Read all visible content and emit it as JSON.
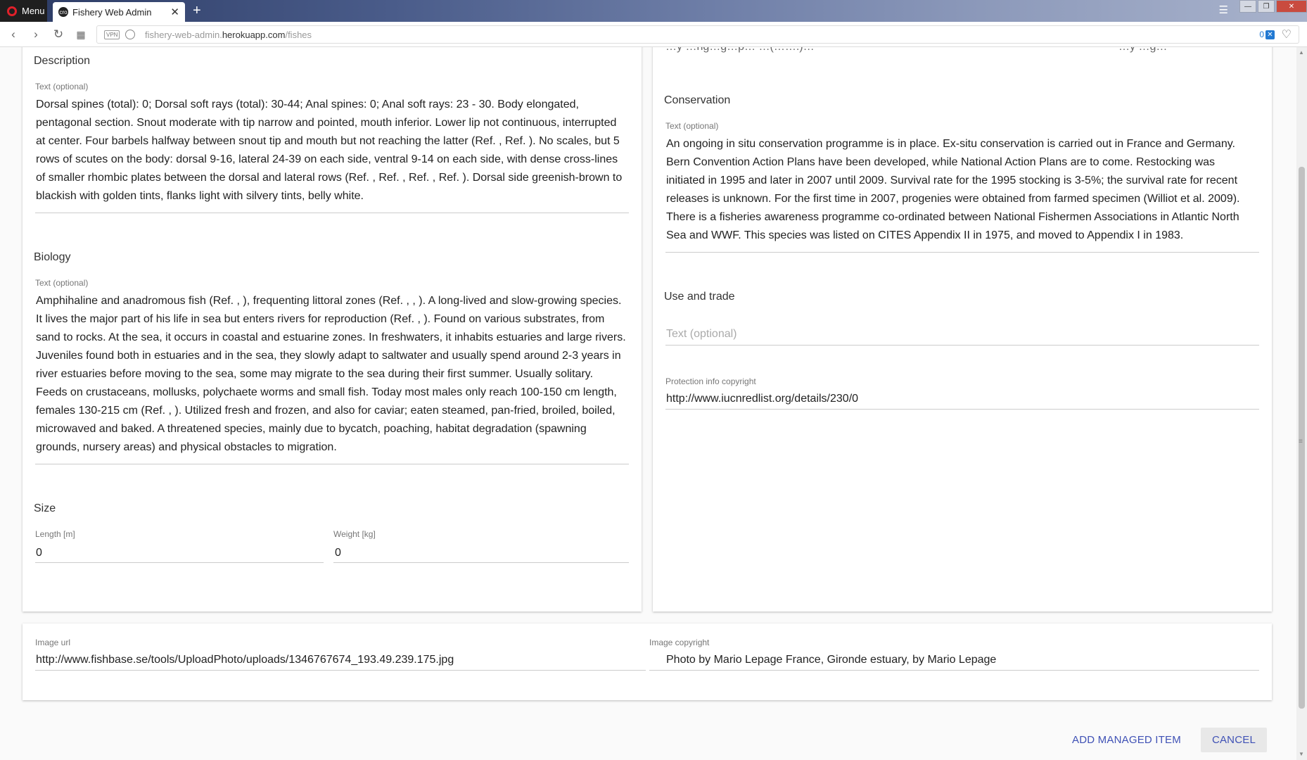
{
  "browser": {
    "menu_label": "Menu",
    "tab_title": "Fishery Web Admin",
    "favicon_text": "cro",
    "url_host_prefix": "fishery-web-admin.",
    "url_host_main": "herokuapp.com",
    "url_path": "/fishes",
    "vpn_label": "VPN",
    "blocker_count": "0",
    "icons": [
      "opera-icon",
      "close-icon",
      "plus-icon",
      "tabs-menu-icon",
      "minimize-icon",
      "maximize-icon",
      "window-close-icon",
      "back-icon",
      "forward-icon",
      "reload-icon",
      "speed-dial-icon",
      "globe-icon",
      "ad-blocker-icon",
      "heart-icon"
    ]
  },
  "left": {
    "description": {
      "title": "Description",
      "label": "Text (optional)",
      "lines": [
        "Dorsal spines (total): 0; Dorsal soft rays (total): 30-44; Anal spines: 0; Anal soft rays: 23 - 30. Body elongated,",
        "pentagonal section. Snout moderate with tip narrow and pointed, mouth inferior. Lower lip not continuous, interrupted",
        "at center. Four barbels halfway between snout tip and mouth but not reaching the latter (Ref. , Ref. ). No scales, but 5",
        "rows of scutes on the body: dorsal 9-16, lateral 24-39 on each side, ventral 9-14 on each side, with dense cross-lines",
        "of smaller rhombic plates between the dorsal and lateral rows (Ref. , Ref. , Ref. , Ref. ). Dorsal side greenish-brown to",
        "blackish with golden tints, flanks light with silvery tints, belly white."
      ]
    },
    "biology": {
      "title": "Biology",
      "label": "Text (optional)",
      "lines": [
        "Amphihaline and anadromous fish (Ref. , ), frequenting littoral zones (Ref. , , ). A long-lived and slow-growing species.",
        "It lives the major part of his life in sea but enters rivers for reproduction (Ref. , ). Found on various substrates, from",
        "sand to rocks. At the sea, it occurs in coastal and estuarine zones. In freshwaters, it inhabits estuaries and large rivers.",
        "Juveniles found both in estuaries and in the sea, they slowly adapt to saltwater and usually spend around 2-3 years in",
        "river estuaries before moving to the sea, some may migrate to the sea during their first summer. Usually solitary.",
        "Feeds on crustaceans, mollusks, polychaete worms and small fish. Today most males only reach 100-150 cm length,",
        "females 130-215 cm (Ref. , ). Utilized fresh and frozen, and also for caviar; eaten steamed, pan-fried, broiled, boiled,",
        "microwaved and baked. A threatened species, mainly due to bycatch, poaching, habitat degradation (spawning",
        "grounds, nursery areas) and physical obstacles to migration."
      ]
    },
    "size": {
      "title": "Size",
      "length_label": "Length [m]",
      "length_value": "0",
      "weight_label": "Weight [kg]",
      "weight_value": "0"
    }
  },
  "right": {
    "top_partial_left": "…y …ng…g…p…                    …(…….)…",
    "top_partial_right": "…y  …g…",
    "conservation": {
      "title": "Conservation",
      "label": "Text (optional)",
      "lines": [
        "An ongoing in situ conservation programme is in place. Ex-situ conservation is carried out in France and Germany.",
        "Bern Convention Action Plans have been developed, while National Action Plans are to come. Restocking was",
        "initiated in 1995 and later in 2007 until 2009. Survival rate for the 1995 stocking is 3-5%; the survival rate for recent",
        "releases is unknown. For the first time in 2007, progenies were obtained from farmed specimen (Williot et al. 2009).",
        "There is a fisheries awareness programme co-ordinated between National Fishermen Associations in Atlantic North",
        "Sea and WWF. This species was listed on CITES Appendix II in 1975, and moved to Appendix I in 1983."
      ]
    },
    "use_trade": {
      "title": "Use and trade",
      "placeholder": "Text (optional)"
    },
    "protection": {
      "label": "Protection info copyright",
      "value": "http://www.iucnredlist.org/details/230/0"
    }
  },
  "image": {
    "url_label": "Image url",
    "url_value": "http://www.fishbase.se/tools/UploadPhoto/uploads/1346767674_193.49.239.175.jpg",
    "copyright_label": "Image copyright",
    "copyright_value": "Photo by Mario Lepage France, Gironde estuary, by Mario Lepage"
  },
  "actions": {
    "add_label": "ADD MANAGED ITEM",
    "cancel_label": "CANCEL"
  }
}
